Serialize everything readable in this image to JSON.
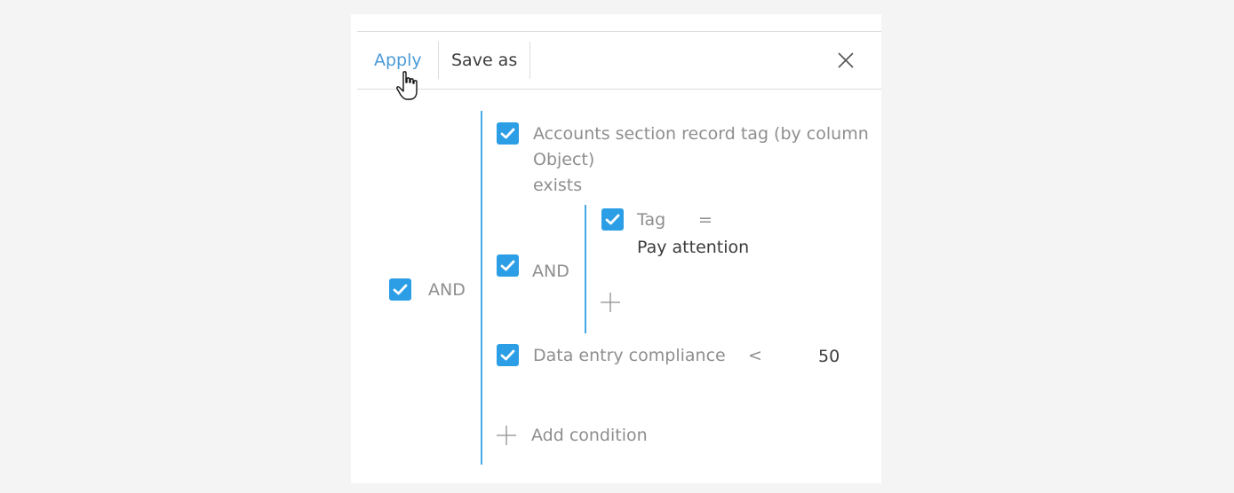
{
  "toolbar": {
    "apply_label": "Apply",
    "save_as_label": "Save as"
  },
  "filter": {
    "root_operator": "AND",
    "conditions": [
      {
        "column_line1": "Accounts section record tag (by column",
        "column_line2": "Object)",
        "operator": "exists",
        "checked": true
      },
      {
        "group_operator": "AND",
        "checked": true,
        "conditions": [
          {
            "column": "Tag",
            "operator": "=",
            "value": "Pay attention",
            "checked": true
          }
        ]
      },
      {
        "column": "Data entry compliance",
        "operator": "<",
        "value": "50",
        "checked": true
      }
    ],
    "add_condition_label": "Add condition"
  },
  "colors": {
    "accent": "#4b9bd9",
    "checkbox": "#2b9ee6",
    "group_line": "#45a9e8"
  },
  "icons": {
    "close": "close-icon",
    "check": "checkmark-icon",
    "plus": "plus-icon",
    "cursor": "hand-pointer-icon"
  }
}
